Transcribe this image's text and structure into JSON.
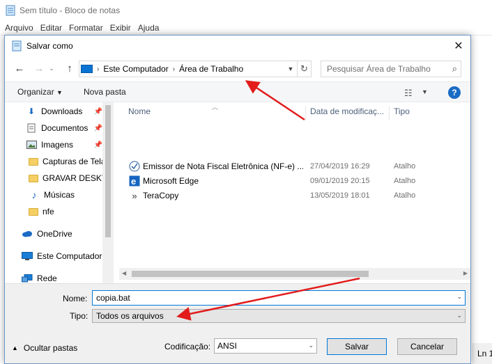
{
  "notepad": {
    "title": "Sem título - Bloco de notas",
    "menu": [
      "Arquivo",
      "Editar",
      "Formatar",
      "Exibir",
      "Ajuda"
    ],
    "status_line": "Ln 1"
  },
  "dialog": {
    "title": "Salvar como",
    "address": {
      "crumbs": [
        "Este Computador",
        "Área de Trabalho"
      ]
    },
    "search": {
      "placeholder": "Pesquisar Área de Trabalho"
    },
    "toolbar": {
      "organize": "Organizar",
      "new_folder": "Nova pasta",
      "help": "?"
    },
    "nav": [
      {
        "label": "Downloads",
        "icon": "download-arrow-icon",
        "pinned": true
      },
      {
        "label": "Documentos",
        "icon": "documents-icon",
        "pinned": true
      },
      {
        "label": "Imagens",
        "icon": "pictures-icon",
        "pinned": true
      },
      {
        "label": "Capturas de Tela",
        "icon": "folder-icon",
        "pinned": false
      },
      {
        "label": "GRAVAR DESKTOP",
        "icon": "folder-icon",
        "pinned": false
      },
      {
        "label": "Músicas",
        "icon": "music-note-icon",
        "pinned": false
      },
      {
        "label": "nfe",
        "icon": "folder-icon",
        "pinned": false
      },
      {
        "label": "OneDrive",
        "icon": "cloud-icon",
        "pinned": false
      },
      {
        "label": "Este Computador",
        "icon": "computer-icon",
        "pinned": false
      },
      {
        "label": "Rede",
        "icon": "network-icon",
        "pinned": false
      }
    ],
    "columns": {
      "name": "Nome",
      "date": "Data de modificaç...",
      "type": "Tipo"
    },
    "files": [
      {
        "name": "Emissor de Nota Fiscal Eletrônica (NF-e) ...",
        "date": "27/04/2019 16:29",
        "type": "Atalho",
        "icon": "nfe-app-icon"
      },
      {
        "name": "Microsoft Edge",
        "date": "09/01/2019 20:15",
        "type": "Atalho",
        "icon": "edge-icon"
      },
      {
        "name": "TeraCopy",
        "date": "13/05/2019 18:01",
        "type": "Atalho",
        "icon": "teracopy-icon"
      }
    ],
    "form": {
      "name_label": "Nome:",
      "name_value": "copia.bat",
      "type_label": "Tipo:",
      "type_value": "Todos os arquivos",
      "hide_folders": "Ocultar pastas",
      "encoding_label": "Codificação:",
      "encoding_value": "ANSI",
      "save": "Salvar",
      "cancel": "Cancelar"
    }
  },
  "colors": {
    "accent": "#0078d7",
    "annotation_arrow": "#e21b1b",
    "folder": "#f5cf63"
  }
}
